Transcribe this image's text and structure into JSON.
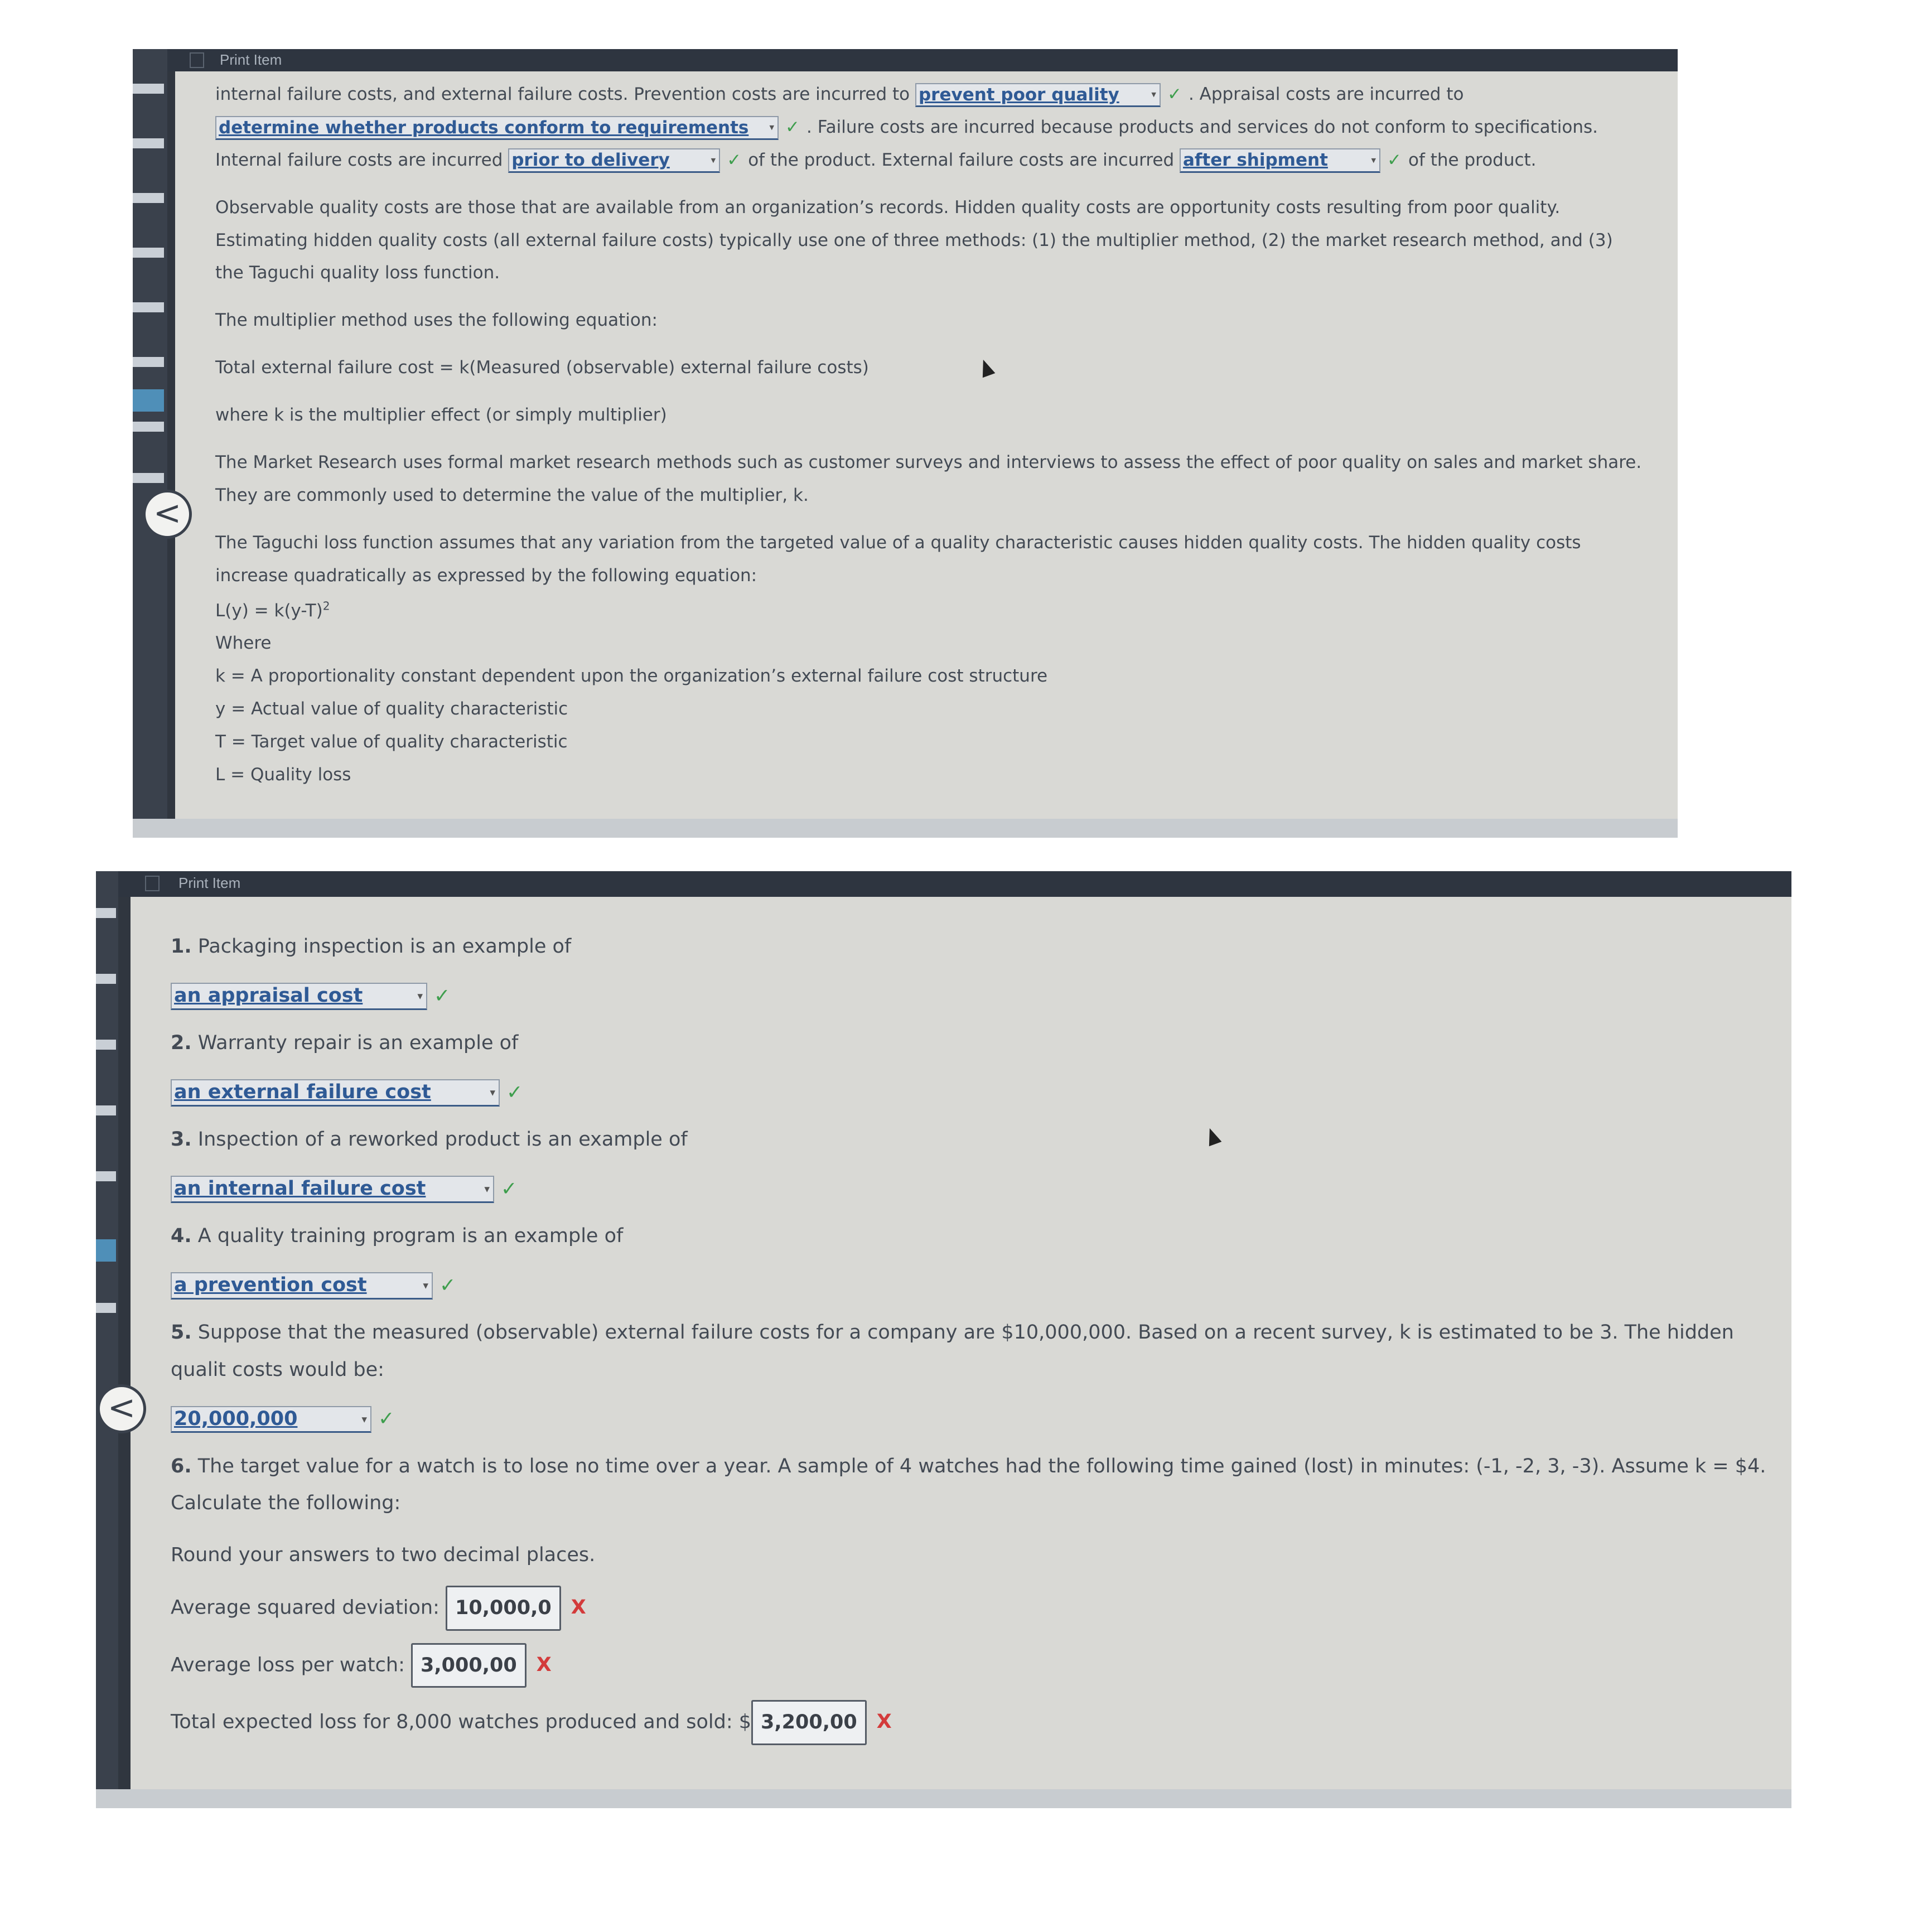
{
  "window_title": "Print Item",
  "top_panel": {
    "line1_start": "internal failure costs, and external failure costs. Prevention costs are incurred to",
    "dd_prevention": "prevent poor quality",
    "line1_end": ". Appraisal costs are incurred to",
    "dd_appraisal": "determine whether products conform to requirements",
    "line2_end": ". Failure costs are incurred because products and services do not conform to specifications.",
    "line3_start": "Internal failure costs are incurred",
    "dd_internal": "prior to delivery",
    "line3_mid": "of the product. External failure costs are incurred",
    "dd_external": "after shipment",
    "line3_end": "of the product.",
    "observable_para": "Observable quality costs are those that are available from an organization’s records. Hidden quality costs are opportunity costs resulting from poor quality. Estimating hidden quality costs (all external failure costs) typically use one of three methods: (1) the multiplier method, (2) the market research method, and (3) the Taguchi quality loss function.",
    "multiplier_intro": "The multiplier method uses the following equation:",
    "multiplier_equation": "Total external failure cost = k(Measured (observable) external failure costs)",
    "multiplier_where": "where k is the multiplier effect (or simply multiplier)",
    "market_para": "The Market Research uses formal market research methods such as customer surveys and interviews to assess the effect of poor quality on sales and market share. They are commonly used to determine the value of the multiplier, k.",
    "taguchi_para": "The Taguchi loss function assumes that any variation from the targeted value of a quality characteristic causes hidden quality costs. The hidden quality costs increase quadratically as expressed by the following equation:",
    "formula_base": "L(y) = k(y-T)",
    "formula_exp": "2",
    "where_label": "Where",
    "def_k": "k = A proportionality constant dependent upon the organization’s external failure cost structure",
    "def_y": "y = Actual value of quality characteristic",
    "def_t": "T = Target value of quality characteristic",
    "def_l": "L = Quality loss"
  },
  "bottom_panel": {
    "questions": [
      {
        "num": "1.",
        "text": "Packaging inspection is an example of",
        "answer": "an appraisal cost",
        "status": "✓"
      },
      {
        "num": "2.",
        "text": "Warranty repair is an example of",
        "answer": "an external failure cost",
        "status": "✓"
      },
      {
        "num": "3.",
        "text": "Inspection of a reworked product is an example of",
        "answer": "an internal failure cost",
        "status": "✓"
      },
      {
        "num": "4.",
        "text": "A quality training program is an example of",
        "answer": "a prevention cost",
        "status": "✓"
      },
      {
        "num": "5.",
        "text": "Suppose that the measured (observable) external failure costs for a company are $10,000,000. Based on a recent survey, k is estimated to be 3. The hidden qualit costs would be:",
        "answer": "20,000,000",
        "status": "✓"
      }
    ],
    "q6_num": "6.",
    "q6_text": "The target value for a watch is to lose no time over a year. A sample of 4 watches had the following time gained (lost) in minutes: (-1, -2, 3, -3). Assume k = $4. Calculate the following:",
    "round_note": "Round your answers to two decimal places.",
    "avg_sq_label": "Average squared deviation:",
    "avg_sq_value": "10,000,0",
    "avg_loss_label": "Average loss per watch:",
    "avg_loss_value": "3,000,00",
    "total_loss_label": "Total expected loss for 8,000 watches produced and sold: $",
    "total_loss_value": "3,200,00",
    "wrong_mark": "X"
  },
  "icons": {
    "check": "✓",
    "caret": "▾",
    "back": "<"
  }
}
